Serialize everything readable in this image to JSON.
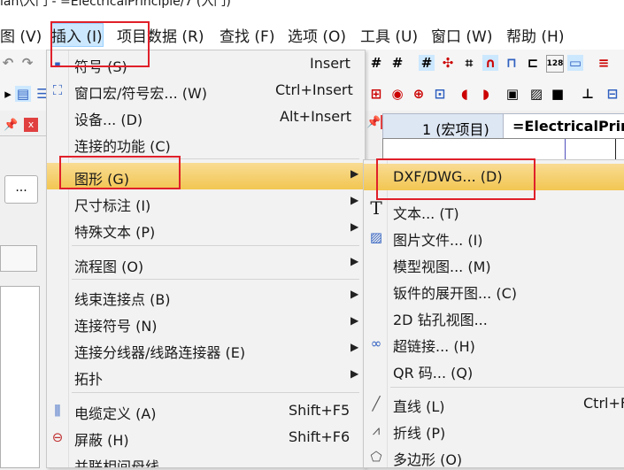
{
  "title": "lan\\入门 - =ElectricalPrinciple/7 (入门)",
  "menubar": {
    "items": [
      "图 (V)",
      "插入 (I)",
      "项目数据 (R)",
      "查找 (F)",
      "选项 (O)",
      "工具 (U)",
      "窗口 (W)",
      "帮助 (H)"
    ]
  },
  "tabs": {
    "macro_project": "1 (宏项目)",
    "electrical": "=ElectricalPrinc"
  },
  "left_panel": {
    "button_label": "..."
  },
  "insert_menu": {
    "items": [
      {
        "label": "符号 (S)",
        "shortcut": "Insert"
      },
      {
        "label": "窗口宏/符号宏... (W)",
        "shortcut": "Ctrl+Insert"
      },
      {
        "label": "设备... (D)",
        "shortcut": "Alt+Insert"
      },
      {
        "label": "连接的功能 (C)"
      },
      {
        "label": "图形 (G)"
      },
      {
        "label": "尺寸标注 (I)"
      },
      {
        "label": "特殊文本 (P)"
      },
      {
        "label": "流程图 (O)"
      },
      {
        "label": "线束连接点 (B)"
      },
      {
        "label": "连接符号 (N)"
      },
      {
        "label": "连接分线器/线路连接器 (E)"
      },
      {
        "label": "拓扑"
      },
      {
        "label": "电缆定义 (A)",
        "shortcut": "Shift+F5"
      },
      {
        "label": "屏蔽 (H)",
        "shortcut": "Shift+F6"
      },
      {
        "label": "并联相间母线"
      }
    ]
  },
  "graphics_submenu": {
    "items": [
      {
        "label": "DXF/DWG... (D)"
      },
      {
        "label": "文本... (T)"
      },
      {
        "label": "图片文件... (I)"
      },
      {
        "label": "模型视图... (M)"
      },
      {
        "label": "钣件的展开图... (C)"
      },
      {
        "label": "2D 钻孔视图..."
      },
      {
        "label": "超链接... (H)"
      },
      {
        "label": "QR 码... (Q)"
      },
      {
        "label": "直线 (L)",
        "shortcut": "Ctrl+F"
      },
      {
        "label": "折线 (P)"
      },
      {
        "label": "多边形 (O)"
      }
    ]
  },
  "colors": {
    "highlight": "#f2c652",
    "annotation_red": "#e0202a",
    "menu_bg": "#f2f2f2"
  }
}
